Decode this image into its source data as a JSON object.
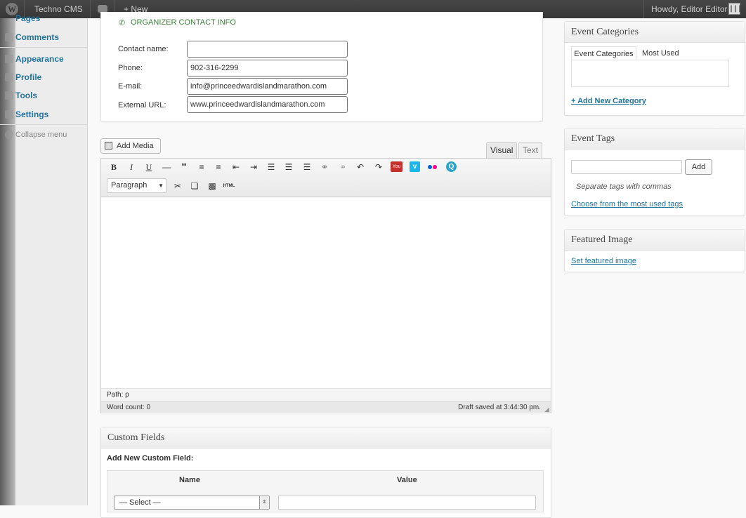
{
  "adminbar": {
    "site_name": "Techno CMS",
    "new_label": "+ New",
    "howdy": "Howdy, Editor Editor"
  },
  "sidebar": {
    "items": [
      {
        "label": "Pages"
      },
      {
        "label": "Comments"
      },
      {
        "label": "Appearance"
      },
      {
        "label": "Profile"
      },
      {
        "label": "Tools"
      },
      {
        "label": "Settings"
      }
    ],
    "collapse_label": "Collapse menu"
  },
  "organizer": {
    "heading": "ORGANIZER CONTACT INFO",
    "fields": [
      {
        "label": "Contact name:",
        "value": ""
      },
      {
        "label": "Phone:",
        "value": "902-316-2299"
      },
      {
        "label": "E-mail:",
        "value": "info@princeedwardislandmarathon.com"
      },
      {
        "label": "External URL:",
        "value": "www.princeedwardislandmarathon.com"
      }
    ]
  },
  "editor": {
    "add_media_label": "Add Media",
    "tab_visual": "Visual",
    "tab_text": "Text",
    "format_select": "Paragraph",
    "path_label": "Path: p",
    "word_count": "Word count: 0",
    "draft_saved": "Draft saved at 3:44:30 pm.",
    "html_label": "HTML"
  },
  "custom_fields": {
    "title": "Custom Fields",
    "add_new_label": "Add New Custom Field:",
    "col_name": "Name",
    "col_value": "Value",
    "select_placeholder": "— Select —"
  },
  "event_categories": {
    "title": "Event Categories",
    "tab_all": "Event Categories",
    "tab_most_used": "Most Used",
    "add_link": "+ Add New Category"
  },
  "event_tags": {
    "title": "Event Tags",
    "add_button": "Add",
    "hint": "Separate tags with commas",
    "choose_link": "Choose from the most used tags"
  },
  "featured_image": {
    "title": "Featured Image",
    "set_link": "Set featured image"
  }
}
